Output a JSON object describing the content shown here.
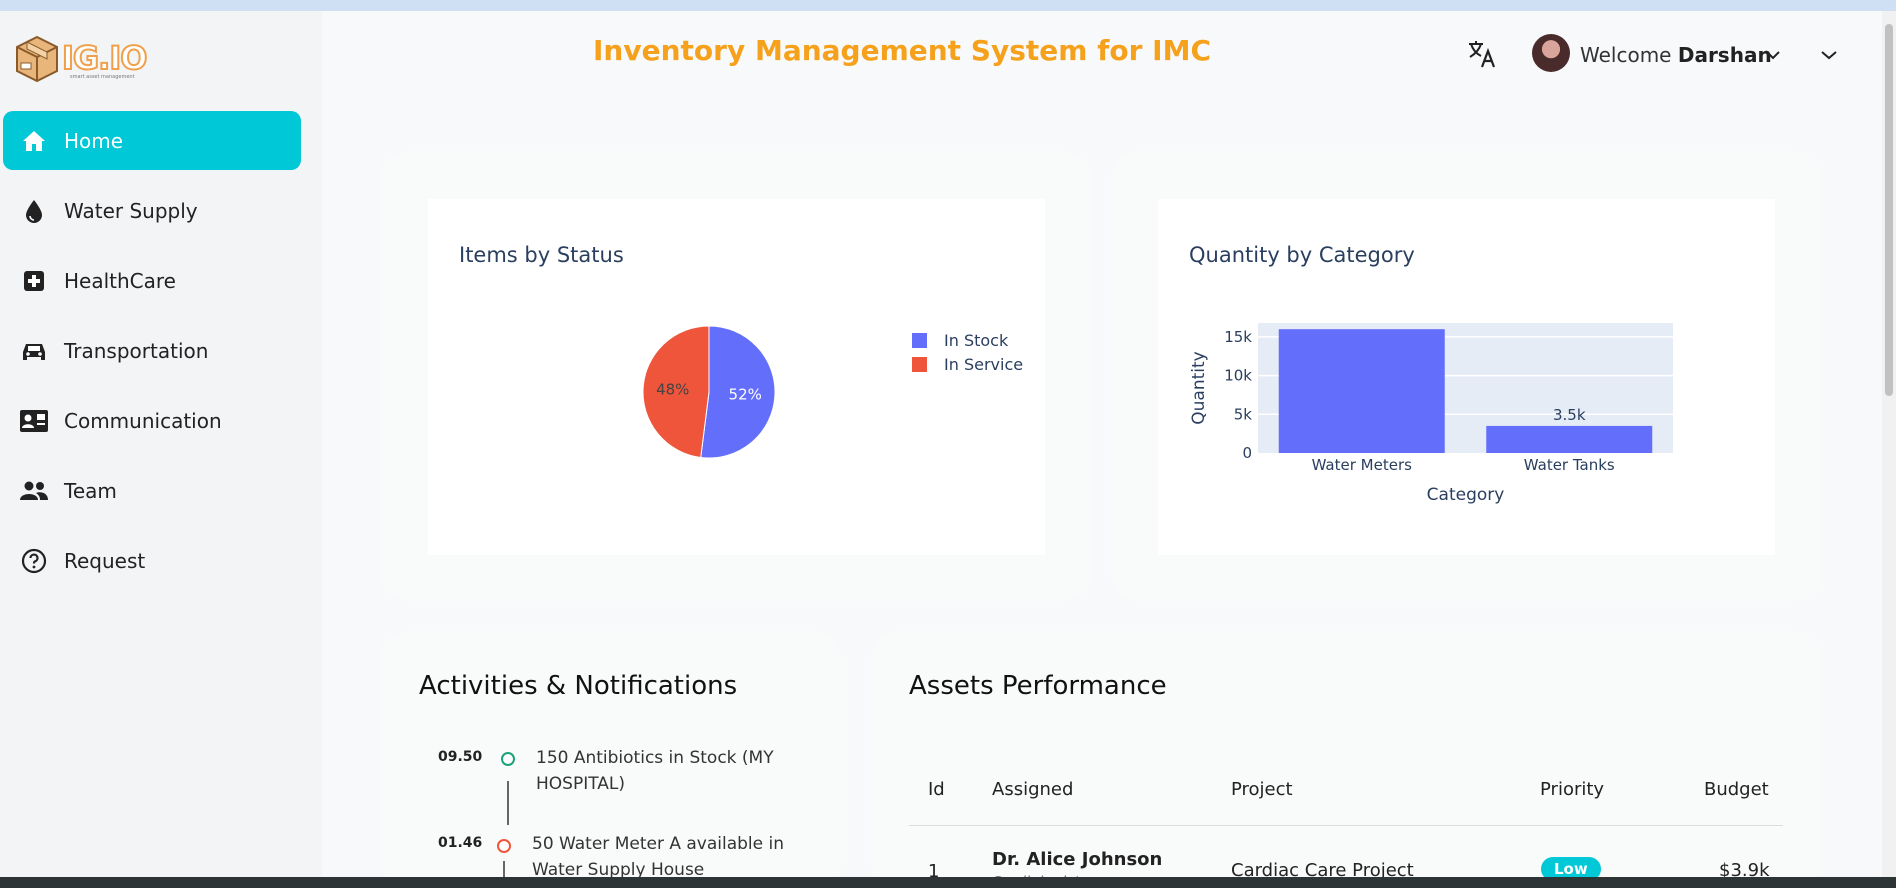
{
  "app": {
    "logo_text": "IG.IO",
    "logo_tagline": "smart asset management",
    "title": "Inventory Management System for IMC"
  },
  "user": {
    "welcome": "Welcome",
    "name": "Darshan"
  },
  "sidebar": {
    "items": [
      {
        "label": "Home",
        "icon": "home-icon",
        "active": true
      },
      {
        "label": "Water Supply",
        "icon": "water-drop-icon",
        "active": false
      },
      {
        "label": "HealthCare",
        "icon": "medical-cross-icon",
        "active": false
      },
      {
        "label": "Transportation",
        "icon": "car-icon",
        "active": false
      },
      {
        "label": "Communication",
        "icon": "contact-card-icon",
        "active": false
      },
      {
        "label": "Team",
        "icon": "people-icon",
        "active": false
      },
      {
        "label": "Request",
        "icon": "help-circle-icon",
        "active": false
      }
    ]
  },
  "colors": {
    "accent": "#00c8d7",
    "title": "#f5a11c",
    "series_blue": "#636efa",
    "series_red": "#ef553b",
    "timeline_green": "#1aa37a",
    "timeline_red": "#ef553b"
  },
  "chart_data": [
    {
      "type": "pie",
      "title": "Items by Status",
      "slices": [
        {
          "name": "In Stock",
          "value": 52,
          "label": "52%"
        },
        {
          "name": "In Service",
          "value": 48,
          "label": "48%"
        }
      ],
      "legend_position": "right"
    },
    {
      "type": "bar",
      "title": "Quantity by Category",
      "categories": [
        "Water Meters",
        "Water Tanks"
      ],
      "values": [
        16000,
        3500
      ],
      "data_labels": [
        "",
        "3.5k"
      ],
      "xlabel": "Category",
      "ylabel": "Quantity",
      "yticks": [
        "0",
        "5k",
        "10k",
        "15k"
      ],
      "ytick_values": [
        0,
        5000,
        10000,
        15000
      ],
      "ylim": [
        0,
        16800
      ],
      "grid": true
    }
  ],
  "activities": {
    "title": "Activities & Notifications",
    "items": [
      {
        "time": "09.50",
        "text": "150 Antibiotics in Stock (MY HOSPITAL)",
        "status": "green"
      },
      {
        "time": "01.46",
        "text": "50 Water Meter A available in Water Supply House",
        "status": "red"
      }
    ]
  },
  "assets": {
    "title": "Assets Performance",
    "columns": [
      "Id",
      "Assigned",
      "Project",
      "Priority",
      "Budget"
    ],
    "rows": [
      {
        "id": "1",
        "assigned": "Dr. Alice Johnson",
        "role": "Cardiologist",
        "project": "Cardiac Care Project",
        "priority": "Low",
        "budget": "$3.9k"
      }
    ]
  }
}
